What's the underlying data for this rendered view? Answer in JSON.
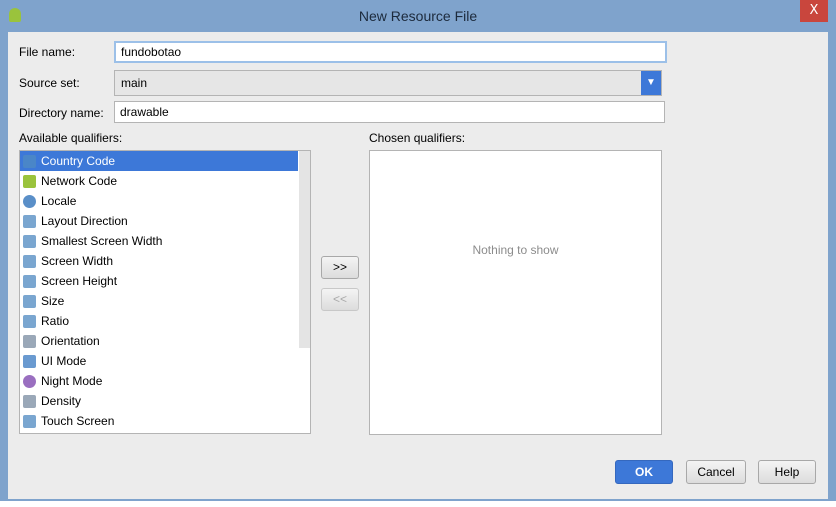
{
  "window": {
    "title": "New Resource File",
    "close_label": "X"
  },
  "form": {
    "file_name": {
      "label": "File name:",
      "value": "fundobotao"
    },
    "source_set": {
      "label": "Source set:",
      "value": "main"
    },
    "directory_name": {
      "label": "Directory name:",
      "value": "drawable"
    }
  },
  "available": {
    "label": "Available qualifiers:",
    "selected": "Country Code",
    "scroll_thumb_fraction": 0.7,
    "items": [
      {
        "label": "Country Code",
        "icon": "country-code-icon",
        "color": "#4a86c8"
      },
      {
        "label": "Network Code",
        "icon": "network-code-icon",
        "color": "#9ac33c"
      },
      {
        "label": "Locale",
        "icon": "globe-icon",
        "color": "#5a8fc8"
      },
      {
        "label": "Layout Direction",
        "icon": "layout-direction-icon",
        "color": "#7aa6d0"
      },
      {
        "label": "Smallest Screen Width",
        "icon": "smallest-width-icon",
        "color": "#7aa6d0"
      },
      {
        "label": "Screen Width",
        "icon": "screen-width-icon",
        "color": "#7aa6d0"
      },
      {
        "label": "Screen Height",
        "icon": "screen-height-icon",
        "color": "#7aa6d0"
      },
      {
        "label": "Size",
        "icon": "size-icon",
        "color": "#7aa6d0"
      },
      {
        "label": "Ratio",
        "icon": "ratio-icon",
        "color": "#7aa6d0"
      },
      {
        "label": "Orientation",
        "icon": "orientation-icon",
        "color": "#9aa8b8"
      },
      {
        "label": "UI Mode",
        "icon": "ui-mode-icon",
        "color": "#6a9ad0"
      },
      {
        "label": "Night Mode",
        "icon": "night-mode-icon",
        "color": "#9a6fc0"
      },
      {
        "label": "Density",
        "icon": "density-icon",
        "color": "#9aa8b8"
      },
      {
        "label": "Touch Screen",
        "icon": "touch-screen-icon",
        "color": "#7aa6d0"
      }
    ]
  },
  "chosen": {
    "label": "Chosen qualifiers:",
    "empty_text": "Nothing to show"
  },
  "buttons": {
    "add": ">>",
    "remove": "<<",
    "ok": "OK",
    "cancel": "Cancel",
    "help": "Help"
  }
}
